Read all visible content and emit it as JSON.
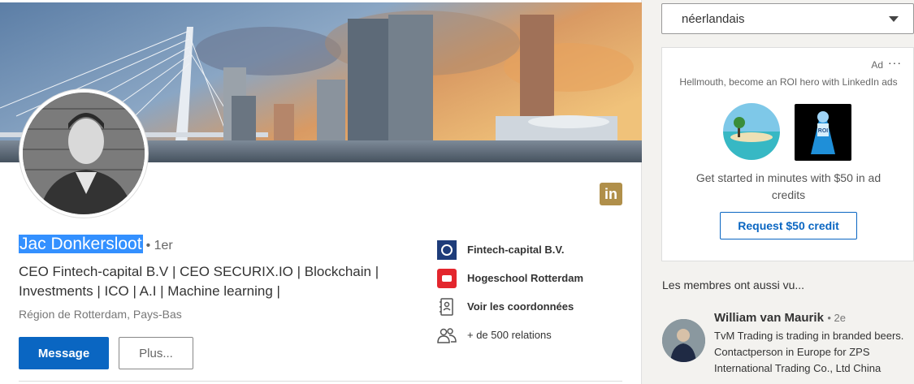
{
  "profile": {
    "name": "Jac Donkersloot",
    "degree": "• 1er",
    "headline": "CEO Fintech-capital B.V | CEO SECURIX.IO | Blockchain | Investments | ICO | A.I | Machine learning |",
    "location": "Région de Rotterdam, Pays-Bas",
    "message_label": "Message",
    "more_label": "Plus...",
    "linkedin_icon_text": "in"
  },
  "side_info": [
    {
      "icon": "fintech-logo",
      "label": "Fintech-capital B.V."
    },
    {
      "icon": "hogeschool-logo",
      "label": "Hogeschool Rotterdam"
    },
    {
      "icon": "contact-card-icon",
      "label": "Voir les coordonnées"
    },
    {
      "icon": "people-icon",
      "label": "+ de 500 relations"
    }
  ],
  "language_select": {
    "selected": "néerlandais"
  },
  "ad": {
    "label": "Ad",
    "dots": "···",
    "tagline": "Hellmouth, become an ROI hero with LinkedIn ads",
    "body": "Get started in minutes with $50 in ad credits",
    "button": "Request $50 credit",
    "hero_text": "ROI"
  },
  "also_viewed": {
    "title": "Les membres ont aussi vu...",
    "members": [
      {
        "name": "William van Maurik",
        "degree": "• 2e",
        "description": "TvM Trading is trading in branded beers. Contactperson in Europe for ZPS International Trading Co., Ltd China"
      }
    ]
  },
  "colors": {
    "accent": "#0a66c2",
    "selection": "#3390ff",
    "linkedin_gold": "#b08f4a"
  }
}
